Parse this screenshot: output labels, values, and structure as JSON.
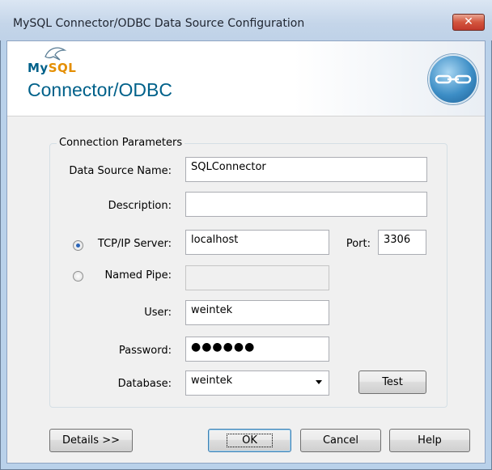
{
  "window": {
    "title": "MySQL Connector/ODBC Data Source Configuration",
    "close_glyph": "✕"
  },
  "banner": {
    "brand_my": "My",
    "brand_sql": "SQL",
    "product": "Connector/ODBC"
  },
  "group": {
    "title": "Connection Parameters"
  },
  "fields": {
    "dsn": {
      "label": "Data Source Name:",
      "value": "SQLConnector"
    },
    "description": {
      "label": "Description:",
      "value": ""
    },
    "tcp": {
      "label": "TCP/IP Server:",
      "value": "localhost",
      "selected": true
    },
    "port": {
      "label": "Port:",
      "value": "3306"
    },
    "pipe": {
      "label": "Named Pipe:",
      "value": ""
    },
    "user": {
      "label": "User:",
      "value": "weintek"
    },
    "password": {
      "label": "Password:",
      "value": "●●●●●●"
    },
    "database": {
      "label": "Database:",
      "value": "weintek"
    }
  },
  "buttons": {
    "test": "Test",
    "details": "Details >>",
    "ok": "OK",
    "cancel": "Cancel",
    "help": "Help"
  },
  "colors": {
    "brand_blue": "#00618a",
    "brand_orange": "#e48e00",
    "close_red": "#c2382b"
  }
}
